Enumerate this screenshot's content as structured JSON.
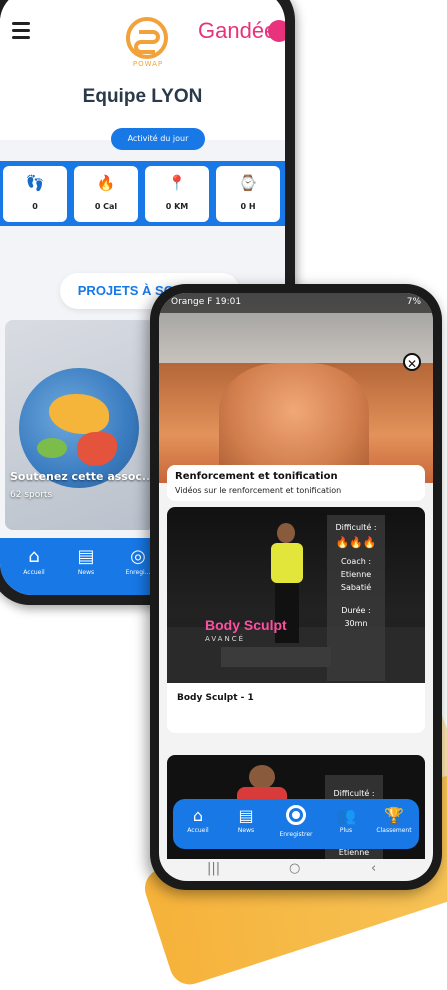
{
  "back_app": {
    "brand_logo_text": "POWAP",
    "partner_logo_text": "Gandée",
    "team_title": "Equipe LYON",
    "activity_button": "Activité du jour",
    "stats": [
      {
        "icon": "footsteps-icon",
        "glyph": "👣",
        "value": "0"
      },
      {
        "icon": "flame-icon",
        "glyph": "🔥",
        "value": "0 Cal"
      },
      {
        "icon": "map-pin-icon",
        "glyph": "📍",
        "value": "0 KM"
      },
      {
        "icon": "watch-icon",
        "glyph": "⌚",
        "value": "0 H"
      }
    ],
    "projects_heading": "PROJETS À SOUTENIR",
    "project_card": {
      "title": "Soutenez cette assoc...",
      "subtitle": "62 sports"
    },
    "nav": [
      {
        "icon": "home-icon",
        "glyph": "⌂",
        "label": "Accueil"
      },
      {
        "icon": "news-icon",
        "glyph": "▤",
        "label": "News"
      },
      {
        "icon": "record-icon",
        "glyph": "◎",
        "label": "Enregi..."
      }
    ]
  },
  "front_app": {
    "status_bar": {
      "left": "Orange F 19:01",
      "right": "7%"
    },
    "close_symbol": "✕",
    "category": {
      "title": "Renforcement et tonification",
      "subtitle": "Vidéos sur le renforcement et tonification"
    },
    "video1": {
      "program_title": "Body Sculpt",
      "level": "AVANCÉ",
      "difficulty_label": "Difficulté :",
      "difficulty_flames": "🔥🔥🔥",
      "coach_label": "Coach :",
      "coach_name_first": "Etienne",
      "coach_name_last": "Sabatié",
      "duration_label": "Durée :",
      "duration_value": "30mn",
      "name": "Body Sculpt - 1"
    },
    "video2": {
      "difficulty_label": "Difficulté :",
      "coach_name_first": "Etienne"
    },
    "nav": [
      {
        "icon": "home-icon",
        "glyph": "⌂",
        "label": "Accueil"
      },
      {
        "icon": "news-icon",
        "glyph": "▤",
        "label": "News"
      },
      {
        "icon": "record-icon",
        "glyph": "",
        "label": "Enregistrer"
      },
      {
        "icon": "users-icon",
        "glyph": "👥",
        "label": "Plus"
      },
      {
        "icon": "podium-icon",
        "glyph": "🏆",
        "label": "Classement"
      }
    ],
    "system_nav": {
      "recents": "|||",
      "home": "○",
      "back": "‹"
    }
  },
  "colors": {
    "primary": "#1778e6",
    "brand_orange": "#f2a23b",
    "partner_pink": "#e8337c",
    "accent_pink": "#ff4fa3"
  }
}
